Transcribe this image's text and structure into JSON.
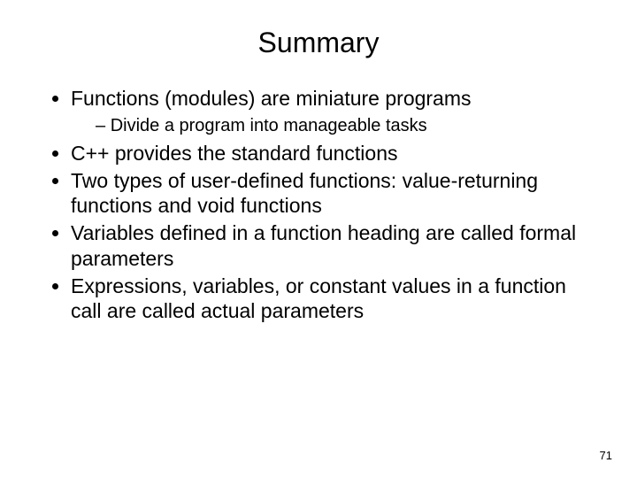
{
  "title": "Summary",
  "bullets": {
    "b1": "Functions (modules) are miniature programs",
    "b1_1": "Divide a program into manageable tasks",
    "b2": "C++ provides the standard functions",
    "b3": "Two types of user-defined functions: value-returning functions and void functions",
    "b4": "Variables defined in a function heading are called formal parameters",
    "b5": "Expressions, variables, or constant values in a function call are called actual parameters"
  },
  "page_number": "71"
}
